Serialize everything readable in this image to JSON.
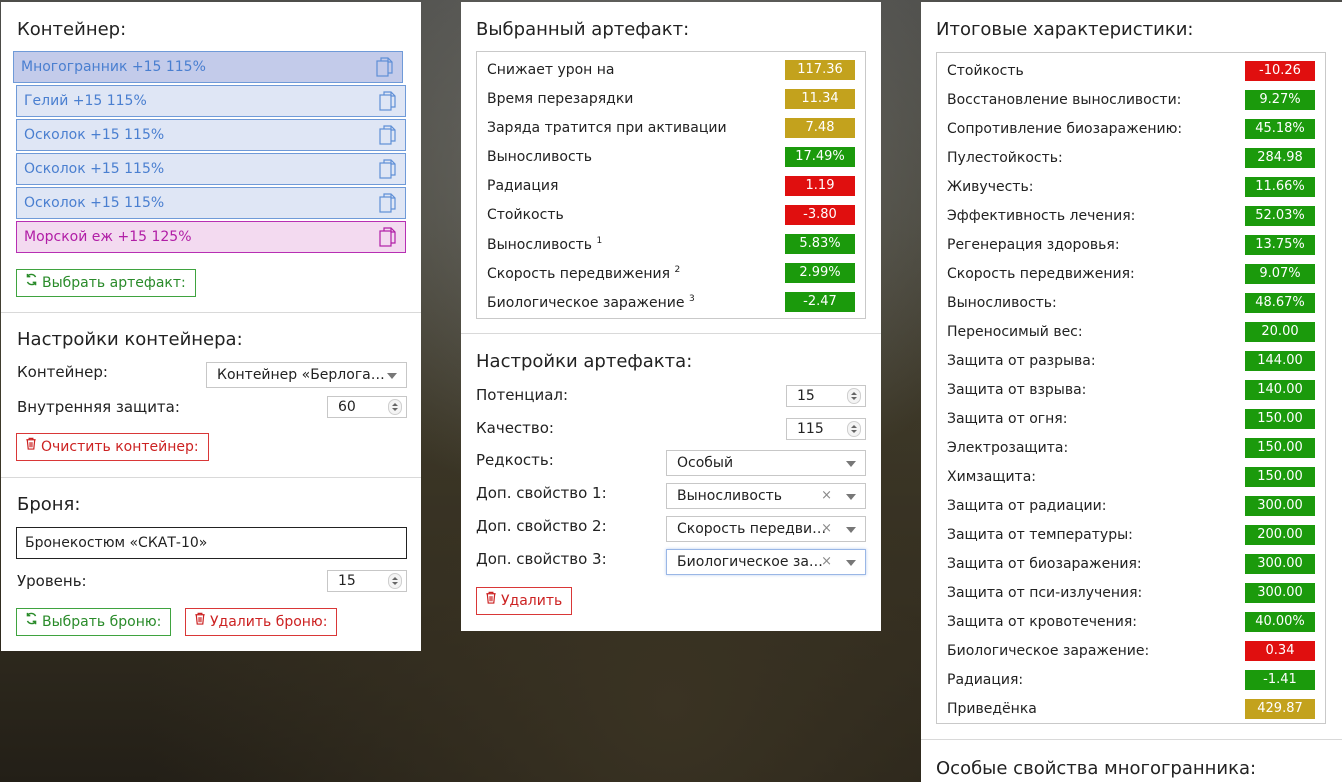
{
  "colors": {
    "green": "#1b9a0c",
    "red": "#e00f0f",
    "yellow": "#c3a21d",
    "slot_blue": "#4a7fd0",
    "slot_purple": "#b11ea6"
  },
  "container": {
    "title": "Контейнер:",
    "slots": [
      {
        "label": "Многогранник +15 115%",
        "style": "active",
        "icon": "copy-icon"
      },
      {
        "label": "Гелий +15 115%",
        "style": "blue",
        "icon": "copy-icon"
      },
      {
        "label": "Осколок +15 115%",
        "style": "blue",
        "icon": "copy-icon"
      },
      {
        "label": "Осколок +15 115%",
        "style": "blue",
        "icon": "copy-icon"
      },
      {
        "label": "Осколок +15 115%",
        "style": "blue",
        "icon": "copy-icon"
      },
      {
        "label": "Морской еж +15 125%",
        "style": "purple",
        "icon": "copy-icon"
      }
    ],
    "choose_button": "Выбрать артефакт:"
  },
  "container_settings": {
    "title": "Настройки контейнера:",
    "container_label": "Контейнер:",
    "container_value": "Контейнер «Берлога…",
    "protection_label": "Внутренняя защита:",
    "protection_value": "60",
    "clear_button": "Очистить контейнер:"
  },
  "armor": {
    "title": "Броня:",
    "armor_value": "Бронекостюм «СКАТ-10»",
    "level_label": "Уровень:",
    "level_value": "15",
    "choose_button": "Выбрать броню:",
    "delete_button": "Удалить броню:"
  },
  "selected_artifact": {
    "title": "Выбранный артефакт:",
    "stats": [
      {
        "name": "Снижает урон на",
        "sup": "",
        "value": "117.36",
        "color": "y"
      },
      {
        "name": "Время перезарядки",
        "sup": "",
        "value": "11.34",
        "color": "y"
      },
      {
        "name": "Заряда тратится при активации",
        "sup": "",
        "value": "7.48",
        "color": "y"
      },
      {
        "name": "Выносливость",
        "sup": "",
        "value": "17.49%",
        "color": "g"
      },
      {
        "name": "Радиация",
        "sup": "",
        "value": "1.19",
        "color": "r"
      },
      {
        "name": "Стойкость",
        "sup": "",
        "value": "-3.80",
        "color": "r"
      },
      {
        "name": "Выносливость",
        "sup": "1",
        "value": "5.83%",
        "color": "g"
      },
      {
        "name": "Скорость передвижения",
        "sup": "2",
        "value": "2.99%",
        "color": "g"
      },
      {
        "name": "Биологическое заражение",
        "sup": "3",
        "value": "-2.47",
        "color": "g"
      }
    ]
  },
  "artifact_settings": {
    "title": "Настройки артефакта:",
    "potential_label": "Потенциал:",
    "potential_value": "15",
    "quality_label": "Качество:",
    "quality_value": "115",
    "rarity_label": "Редкость:",
    "rarity_value": "Особый",
    "prop1_label": "Доп. свойство 1:",
    "prop1_value": "Выносливость",
    "prop2_label": "Доп. свойство 2:",
    "prop2_value": "Скорость передви…",
    "prop3_label": "Доп. свойство 3:",
    "prop3_value": "Биологическое за…",
    "clear_symbol": "×",
    "delete_button": "Удалить"
  },
  "totals": {
    "title": "Итоговые характеристики:",
    "stats": [
      {
        "name": "Стойкость",
        "value": "-10.26",
        "color": "r"
      },
      {
        "name": "Восстановление выносливости:",
        "value": "9.27%",
        "color": "g"
      },
      {
        "name": "Сопротивление биозаражению:",
        "value": "45.18%",
        "color": "g"
      },
      {
        "name": "Пулестойкость:",
        "value": "284.98",
        "color": "g"
      },
      {
        "name": "Живучесть:",
        "value": "11.66%",
        "color": "g"
      },
      {
        "name": "Эффективность лечения:",
        "value": "52.03%",
        "color": "g"
      },
      {
        "name": "Регенерация здоровья:",
        "value": "13.75%",
        "color": "g"
      },
      {
        "name": "Скорость передвижения:",
        "value": "9.07%",
        "color": "g"
      },
      {
        "name": "Выносливость:",
        "value": "48.67%",
        "color": "g"
      },
      {
        "name": "Переносимый вес:",
        "value": "20.00",
        "color": "g"
      },
      {
        "name": "Защита от разрыва:",
        "value": "144.00",
        "color": "g"
      },
      {
        "name": "Защита от взрыва:",
        "value": "140.00",
        "color": "g"
      },
      {
        "name": "Защита от огня:",
        "value": "150.00",
        "color": "g"
      },
      {
        "name": "Электрозащита:",
        "value": "150.00",
        "color": "g"
      },
      {
        "name": "Химзащита:",
        "value": "150.00",
        "color": "g"
      },
      {
        "name": "Защита от радиации:",
        "value": "300.00",
        "color": "g"
      },
      {
        "name": "Защита от температуры:",
        "value": "200.00",
        "color": "g"
      },
      {
        "name": "Защита от биозаражения:",
        "value": "300.00",
        "color": "g"
      },
      {
        "name": "Защита от пси-излучения:",
        "value": "300.00",
        "color": "g"
      },
      {
        "name": "Защита от кровотечения:",
        "value": "40.00%",
        "color": "g"
      },
      {
        "name": "Биологическое заражение:",
        "value": "0.34",
        "color": "r"
      },
      {
        "name": "Радиация:",
        "value": "-1.41",
        "color": "g"
      },
      {
        "name": "Приведёнка",
        "value": "429.87",
        "color": "y"
      }
    ]
  },
  "special": {
    "title": "Особые свойства многогранника:"
  }
}
